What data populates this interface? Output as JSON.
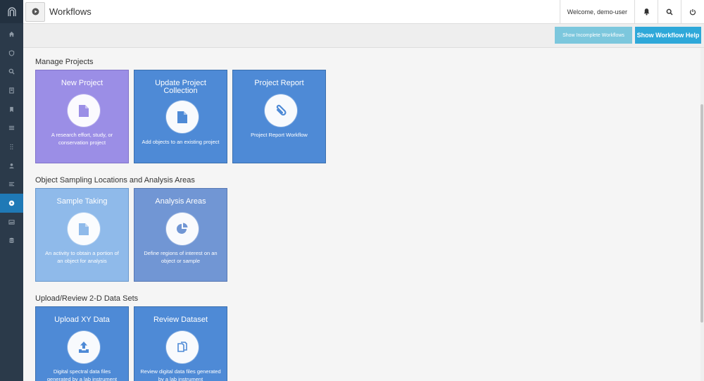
{
  "sidebar": {
    "logo_icon": "arch-logo-icon",
    "items": [
      {
        "icon": "home-icon"
      },
      {
        "icon": "shield-icon"
      },
      {
        "icon": "search-icon"
      },
      {
        "icon": "book-icon"
      },
      {
        "icon": "bookmark-icon"
      },
      {
        "icon": "list-icon"
      },
      {
        "icon": "vertical-dots-icon"
      },
      {
        "icon": "user-icon"
      },
      {
        "icon": "lines-icon"
      },
      {
        "icon": "play-circle-icon",
        "active": true
      },
      {
        "icon": "image-icon"
      },
      {
        "icon": "database-icon"
      }
    ]
  },
  "header": {
    "title": "Workflows",
    "welcome": "Welcome, demo-user"
  },
  "toolbar": {
    "incomplete_label": "Show Incomplete Workflows",
    "help_label": "Show Workflow Help"
  },
  "sections": [
    {
      "title": "Manage Projects",
      "cards": [
        {
          "title": "New Project",
          "description": "A research effort, study, or conservation project",
          "icon": "document-icon"
        },
        {
          "title": "Update Project Collection",
          "description": "Add objects to an existing project",
          "icon": "document-icon"
        },
        {
          "title": "Project Report",
          "description": "Project Report Workflow",
          "icon": "paperclip-icon"
        }
      ]
    },
    {
      "title": "Object Sampling Locations and Analysis Areas",
      "cards": [
        {
          "title": "Sample Taking",
          "description": "An activity to obtain a portion of an object for analysis",
          "icon": "document-icon"
        },
        {
          "title": "Analysis Areas",
          "description": "Define regions of interest on an object or sample",
          "icon": "pie-chart-icon"
        }
      ]
    },
    {
      "title": "Upload/Review 2-D Data Sets",
      "cards": [
        {
          "title": "Upload XY Data",
          "description": "Digital spectral data files generated by a lab instrument",
          "icon": "upload-icon"
        },
        {
          "title": "Review Dataset",
          "description": "Review digital data files generated by a lab instrument",
          "icon": "copy-icon"
        }
      ]
    }
  ],
  "colors": {
    "sidebar": "#2b3a4a",
    "sidebar_active": "#1f79b6",
    "card_purple": "#9b8ee6",
    "card_blue": "#4e8ad6",
    "card_lightblue": "#8fbaea",
    "card_steel": "#7196d4",
    "help_button": "#2ea8d9",
    "incomplete_button": "#7cc7dd"
  }
}
